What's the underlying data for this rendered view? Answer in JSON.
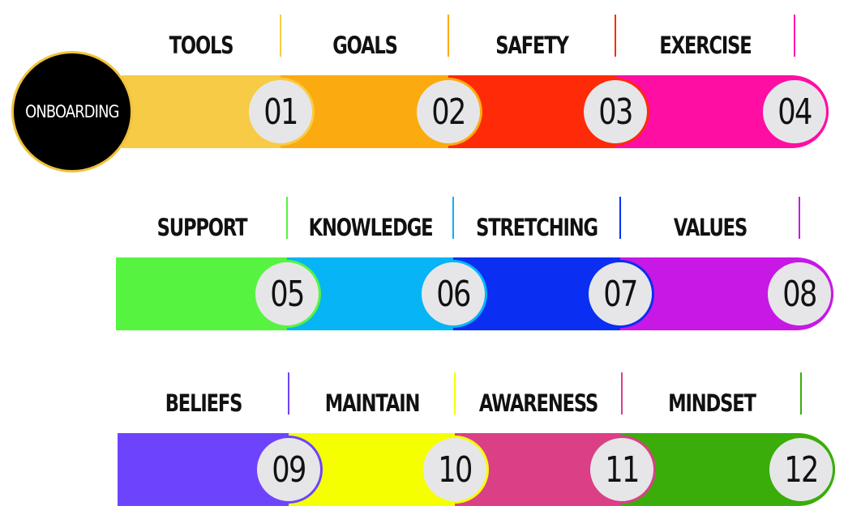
{
  "start": {
    "label": "ONBOARDING"
  },
  "steps": [
    {
      "number": "01",
      "label": "TOOLS",
      "color": "#f7cb45"
    },
    {
      "number": "02",
      "label": "GOALS",
      "color": "#fbaa0f"
    },
    {
      "number": "03",
      "label": "SAFETY",
      "color": "#ff2a07"
    },
    {
      "number": "04",
      "label": "EXERCISE",
      "color": "#fe0ea3"
    },
    {
      "number": "05",
      "label": "SUPPORT",
      "color": "#56f440"
    },
    {
      "number": "06",
      "label": "KNOWLEDGE",
      "color": "#07b4f5"
    },
    {
      "number": "07",
      "label": "STRETCHING",
      "color": "#0a2ef2"
    },
    {
      "number": "08",
      "label": "VALUES",
      "color": "#c718e6"
    },
    {
      "number": "09",
      "label": "BELIEFS",
      "color": "#6d44fb"
    },
    {
      "number": "10",
      "label": "MAINTAIN",
      "color": "#f5ff00"
    },
    {
      "number": "11",
      "label": "AWARENESS",
      "color": "#db3f86"
    },
    {
      "number": "12",
      "label": "MINDSET",
      "color": "#3aad0a"
    }
  ]
}
